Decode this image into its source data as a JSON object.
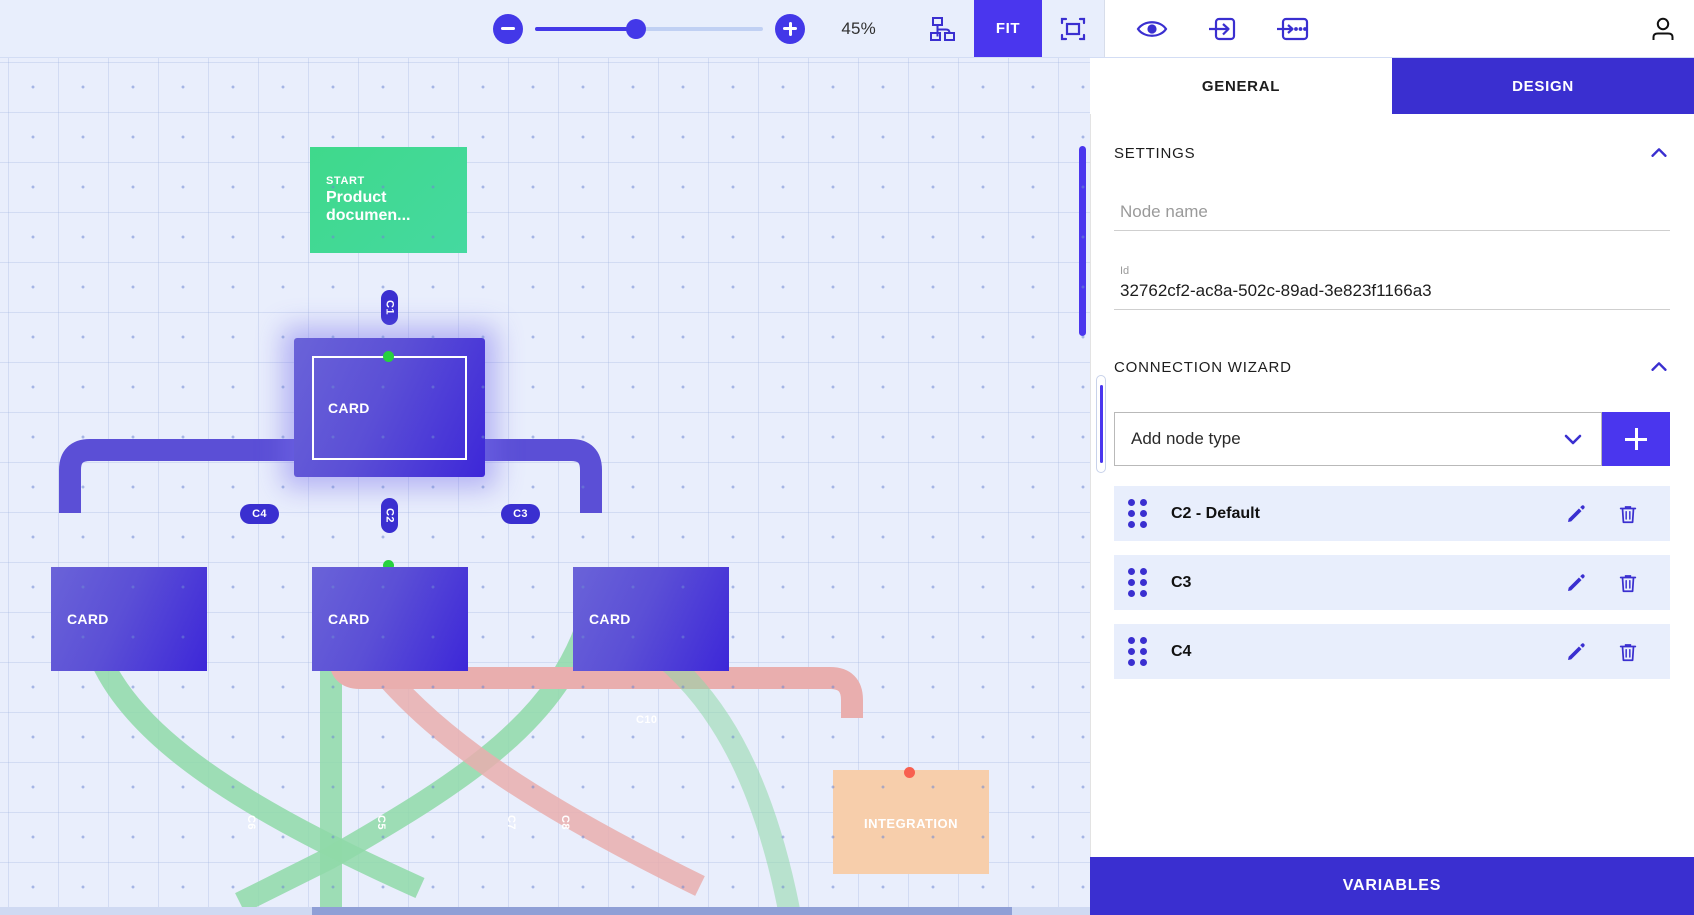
{
  "toolbar": {
    "zoom_out_icon": "minus-circle-icon",
    "zoom_in_icon": "plus-circle-icon",
    "zoom_level": "45%",
    "slider_position_pct": 44,
    "auto_layout_icon": "hierarchy-layout-icon",
    "fit_label": "FIT",
    "fullscreen_icon": "fullscreen-icon",
    "preview_icon": "eye-icon",
    "enter_icon": "arrow-into-box-icon",
    "enter_more_icon": "arrow-into-box-dots-icon",
    "account_icon": "user-avatar-icon"
  },
  "canvas": {
    "nodes": [
      {
        "id": "start",
        "kicker": "START",
        "title": "Product documen...",
        "type": "start"
      },
      {
        "id": "card-selected",
        "label": "CARD",
        "type": "card",
        "selected": true
      },
      {
        "id": "card-left",
        "label": "CARD",
        "type": "card"
      },
      {
        "id": "card-mid",
        "label": "CARD",
        "type": "card"
      },
      {
        "id": "card-right",
        "label": "CARD",
        "type": "card"
      },
      {
        "id": "integration",
        "label": "INTEGRATION",
        "type": "integration"
      }
    ],
    "edges": [
      {
        "id": "C1",
        "label": "C1",
        "orientation": "vertical"
      },
      {
        "id": "C2",
        "label": "C2",
        "orientation": "vertical"
      },
      {
        "id": "C3",
        "label": "C3",
        "orientation": "horizontal"
      },
      {
        "id": "C4",
        "label": "C4",
        "orientation": "horizontal"
      },
      {
        "id": "C5",
        "label": "C5",
        "orientation": "vertical"
      },
      {
        "id": "C6",
        "label": "C6",
        "orientation": "diagonal"
      },
      {
        "id": "C7",
        "label": "C7",
        "orientation": "diagonal"
      },
      {
        "id": "C8",
        "label": "C8",
        "orientation": "diagonal"
      },
      {
        "id": "C10",
        "label": "C10",
        "orientation": "horizontal"
      }
    ],
    "colors": {
      "background": "#e9eefc",
      "start_node": "#3fd98b",
      "card_node": "#4f40d8",
      "integration_node": "#f7ceab",
      "edge_primary": "#5b4fd6",
      "edge_green": "#8fd9a8",
      "edge_red": "#e9aeae",
      "port_green": "#27d13f",
      "port_red": "#f8604f"
    }
  },
  "panel": {
    "tabs": [
      {
        "id": "general",
        "label": "GENERAL",
        "active": false
      },
      {
        "id": "design",
        "label": "DESIGN",
        "active": true
      }
    ],
    "settings": {
      "heading": "SETTINGS",
      "collapse_icon": "chevron-up-icon",
      "node_name": {
        "label": "Node name",
        "placeholder": "Node name",
        "value": ""
      },
      "id": {
        "label": "Id",
        "value": "32762cf2-ac8a-502c-89ad-3e823f1166a3"
      }
    },
    "connection_wizard": {
      "heading": "CONNECTION WIZARD",
      "collapse_icon": "chevron-up-icon",
      "select": {
        "value": "Add node type",
        "dropdown_icon": "chevron-down-icon"
      },
      "add_button_icon": "plus-icon",
      "connections": [
        {
          "name": "C2 - Default",
          "drag_icon": "drag-handle-icon",
          "edit_icon": "pencil-icon",
          "delete_icon": "trash-icon"
        },
        {
          "name": "C3",
          "drag_icon": "drag-handle-icon",
          "edit_icon": "pencil-icon",
          "delete_icon": "trash-icon"
        },
        {
          "name": "C4",
          "drag_icon": "drag-handle-icon",
          "edit_icon": "pencil-icon",
          "delete_icon": "trash-icon"
        }
      ]
    },
    "variables_label": "VARIABLES",
    "accent_color": "#3a2fd0"
  }
}
